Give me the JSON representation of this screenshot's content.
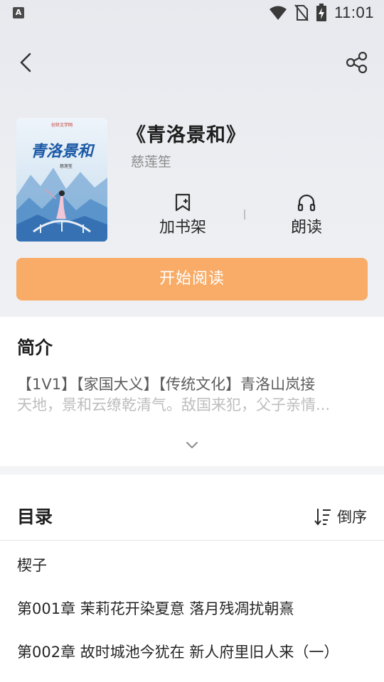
{
  "status_bar": {
    "app_icon_letter": "A",
    "time": "11:01"
  },
  "book": {
    "title": "《青洛景和》",
    "author": "慈莲笙",
    "cover_title": "青洛景和",
    "cover_author": "慈莲笙",
    "cover_publisher": "创世文学网"
  },
  "actions": {
    "add_shelf": "加书架",
    "read_aloud": "朗读",
    "start_reading": "开始阅读"
  },
  "intro": {
    "heading": "简介",
    "line1": "【1V1】【家国大义】【传统文化】青洛山岚接",
    "line2": "天地，景和云缭乾清气。敌国来犯，父子亲情..."
  },
  "catalog": {
    "heading": "目录",
    "sort_label": "倒序",
    "chapters": [
      "楔子",
      "第001章 茉莉花开染夏意 落月残凋扰朝熹",
      "第002章 故时城池今犹在 新人府里旧人来（一）"
    ]
  },
  "colors": {
    "accent": "#f8ac68",
    "header_bg": "#e9ebef",
    "text_primary": "#1f1f1f",
    "text_secondary": "#8c8c8c"
  }
}
